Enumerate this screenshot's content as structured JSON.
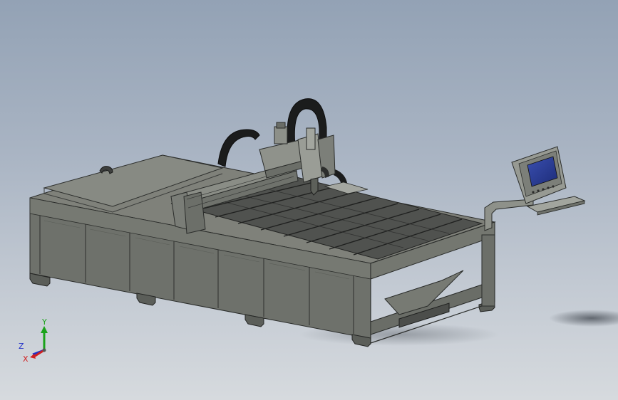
{
  "view": {
    "background_top": "#93a2b5",
    "background_bottom": "#d6dade"
  },
  "triad": {
    "y_label": "Y",
    "z_label": "Z",
    "x_label": "X",
    "y_color": "#1aa31a",
    "x_color": "#d02020",
    "z_color": "#2030c8"
  }
}
